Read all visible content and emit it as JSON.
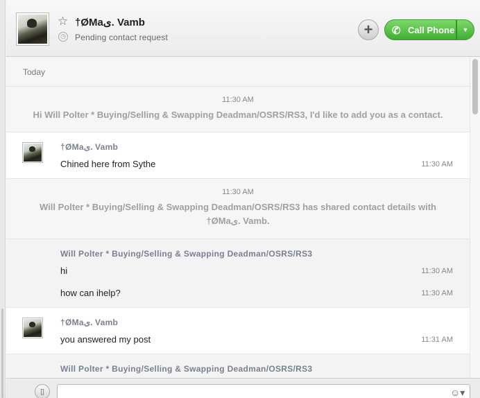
{
  "contact": {
    "name": "†ØMaی. Vamb",
    "status": "Pending contact request"
  },
  "header_buttons": {
    "add": "+",
    "call_label": "Call Phone",
    "call_dropdown": "▼"
  },
  "conversation": {
    "day_label": "Today",
    "sys1": {
      "time": "11:30 AM",
      "text": "Hi Will Polter * Buying/Selling & Swapping Deadman/OSRS/RS3, I'd like to add you as a contact."
    },
    "g1": {
      "sender": "†ØMaی. Vamb",
      "messages": [
        {
          "text": "Chined here from Sythe",
          "time": "11:30 AM"
        }
      ]
    },
    "sys2": {
      "time": "11:30 AM",
      "text": "Will Polter * Buying/Selling & Swapping Deadman/OSRS/RS3 has shared contact details with †ØMaی. Vamb."
    },
    "g2": {
      "sender": "Will Polter * Buying/Selling & Swapping Deadman/OSRS/RS3",
      "messages": [
        {
          "text": "hi",
          "time": "11:30 AM"
        },
        {
          "text": "how can ihelp?",
          "time": "11:30 AM"
        }
      ]
    },
    "g3": {
      "sender": "†ØMaی. Vamb",
      "messages": [
        {
          "text": "you answered my post",
          "time": "11:31 AM"
        }
      ]
    },
    "g4": {
      "sender": "Will Polter * Buying/Selling & Swapping Deadman/OSRS/RS3"
    }
  },
  "icons": {
    "star": "star-icon",
    "pending": "clock-icon",
    "phone": "phone-icon",
    "device": "mobile-device-icon",
    "emoji": "emoticon-icon"
  }
}
